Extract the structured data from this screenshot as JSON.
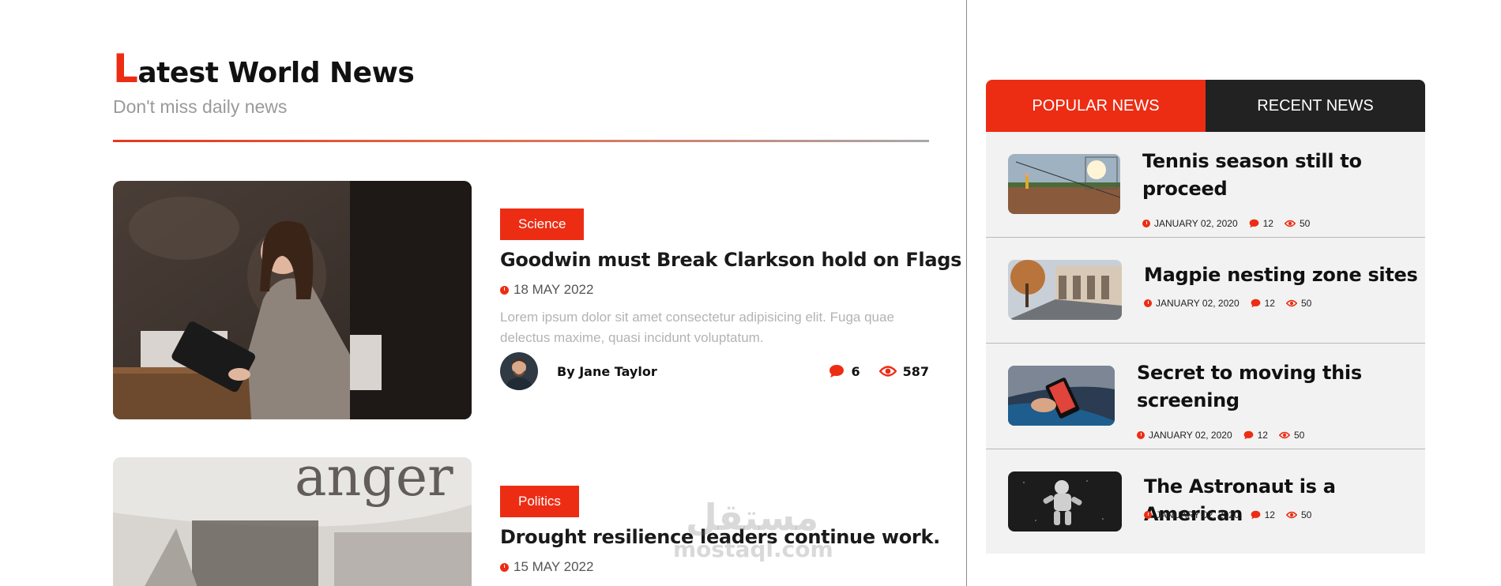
{
  "section": {
    "title_first_letter": "L",
    "title_rest": "atest World News",
    "subtitle": "Don't miss daily news"
  },
  "articles": [
    {
      "category": "Science",
      "title": "Goodwin must Break Clarkson hold on Flags",
      "date": "18 MAY 2022",
      "excerpt": "Lorem ipsum dolor sit amet consectetur adipisicing elit. Fuga quae delectus maxime, quasi incidunt voluptatum.",
      "author": "By Jane Taylor",
      "comments": "6",
      "views": "587"
    },
    {
      "category": "Politics",
      "title": "Drought resilience leaders continue work.",
      "date": "15 MAY 2022"
    }
  ],
  "sidebar": {
    "tabs": [
      {
        "label": "POPULAR NEWS",
        "active": true
      },
      {
        "label": "RECENT NEWS",
        "active": false
      }
    ],
    "items": [
      {
        "title_line1": "Tennis season still to",
        "title_line2": "proceed",
        "date": "JANUARY 02, 2020",
        "comments": "12",
        "views": "50"
      },
      {
        "title_line1": "Magpie nesting zone sites",
        "title_line2": "",
        "date": "JANUARY 02, 2020",
        "comments": "12",
        "views": "50"
      },
      {
        "title_line1": "Secret to moving this",
        "title_line2": "screening",
        "date": "JANUARY 02, 2020",
        "comments": "12",
        "views": "50"
      },
      {
        "title_line1": "The Astronaut is a American",
        "title_line2": "",
        "date": "JANUARY 02, 2020",
        "comments": "12",
        "views": "50"
      }
    ]
  },
  "watermark": {
    "arabic": "مستقل",
    "latin": "mostaql.com"
  },
  "colors": {
    "accent": "#ec2d14",
    "dark_tab": "#222222",
    "sidebar_bg": "#f2f2f2"
  },
  "icons": [
    "clock-icon",
    "comment-icon",
    "eye-icon"
  ]
}
